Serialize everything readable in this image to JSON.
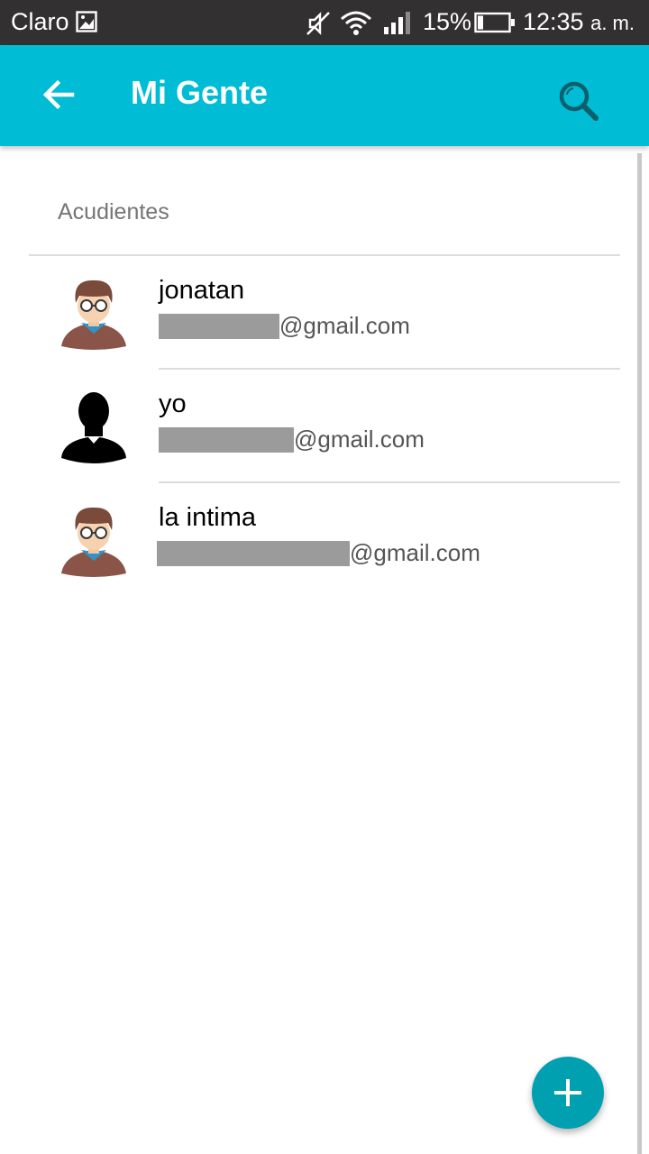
{
  "status_bar": {
    "carrier": "Claro",
    "battery_percent": "15%",
    "time": "12:35",
    "ampm": "a. m.",
    "icons": [
      "image-notification-icon",
      "mute-icon",
      "wifi-icon",
      "signal-icon",
      "battery-icon"
    ]
  },
  "app_bar": {
    "title": "Mi Gente",
    "background_color": "#00bcd4",
    "back_icon": "arrow-back-icon",
    "search_icon": "search-icon"
  },
  "section": {
    "header": "Acudientes"
  },
  "contacts": [
    {
      "name": "jonatan",
      "email_suffix": "@gmail.com",
      "avatar": "glasses-man-avatar"
    },
    {
      "name": "yo",
      "email_suffix": "@gmail.com",
      "avatar": "silhouette-avatar"
    },
    {
      "name": "la intima",
      "email_suffix": "@gmail.com",
      "avatar": "glasses-man-avatar"
    }
  ],
  "fab": {
    "icon": "plus-icon",
    "color": "#00a0b0"
  }
}
